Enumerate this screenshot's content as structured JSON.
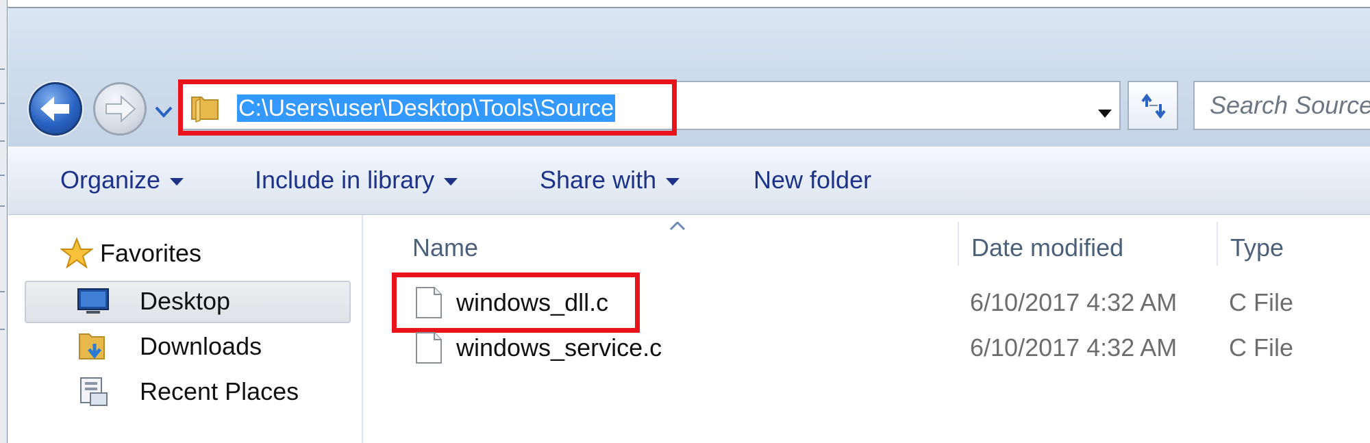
{
  "address_bar": {
    "path": "C:\\Users\\user\\Desktop\\Tools\\Source"
  },
  "search": {
    "placeholder": "Search Source"
  },
  "toolbar": {
    "organize": "Organize",
    "include_in_library": "Include in library",
    "share_with": "Share with",
    "new_folder": "New folder"
  },
  "navigation": {
    "favorites": "Favorites",
    "items": [
      {
        "label": "Desktop",
        "icon": "desktop-icon",
        "selected": true
      },
      {
        "label": "Downloads",
        "icon": "downloads-folder-icon",
        "selected": false
      },
      {
        "label": "Recent Places",
        "icon": "recent-places-icon",
        "selected": false
      }
    ]
  },
  "columns": {
    "name": "Name",
    "date_modified": "Date modified",
    "type": "Type"
  },
  "files": [
    {
      "name": "windows_dll.c",
      "date_modified": "6/10/2017 4:32 AM",
      "type": "C File",
      "highlighted": true
    },
    {
      "name": "windows_service.c",
      "date_modified": "6/10/2017 4:32 AM",
      "type": "C File",
      "highlighted": false
    }
  ],
  "colors": {
    "highlight_box": "#e8131b",
    "selection_blue": "#3399ff",
    "command_text": "#1e3287"
  }
}
